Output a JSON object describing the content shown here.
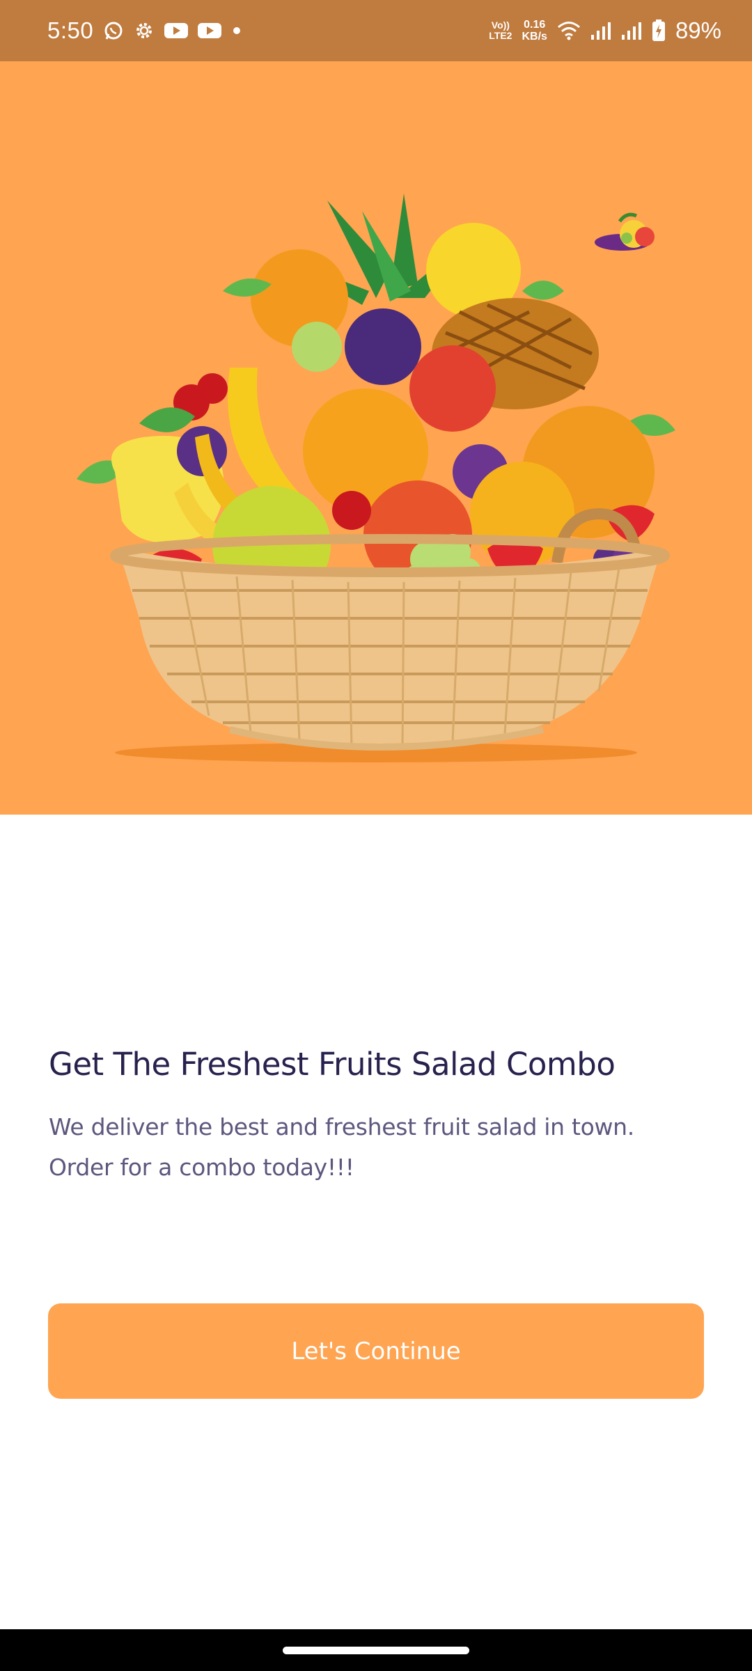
{
  "status_bar": {
    "time": "5:50",
    "left_icons": [
      "whatsapp-icon",
      "settings-gear-icon",
      "youtube-icon",
      "youtube-icon",
      "dot-icon"
    ],
    "volte_top": "Vo))",
    "volte_bottom": "LTE2",
    "net_speed_value": "0.16",
    "net_speed_unit": "KB/s",
    "right_icons": [
      "wifi-icon",
      "signal-icon",
      "signal-icon",
      "battery-charging-icon"
    ],
    "battery_percent": "89%",
    "color": "#c07b3e"
  },
  "hero": {
    "image": "fruit-basket-illustration",
    "background_color": "#ffa451"
  },
  "onboarding": {
    "title": "Get The Freshest Fruits Salad Combo",
    "description": "We deliver the best and freshest fruit salad in town. Order for a combo today!!!",
    "button_label": "Let's Continue",
    "title_color": "#27214d",
    "text_color": "#5d577e",
    "accent_color": "#ffa451"
  }
}
